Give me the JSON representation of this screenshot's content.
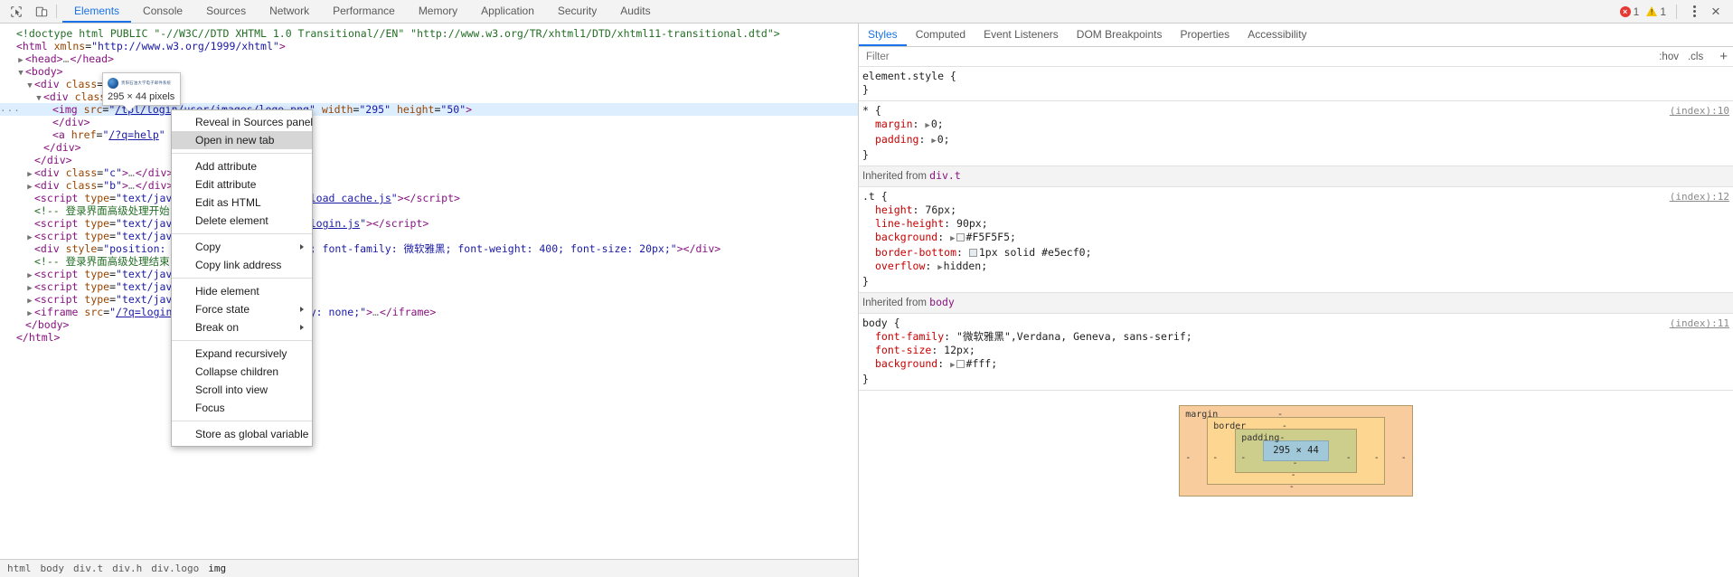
{
  "toolbar": {
    "icons": [
      {
        "name": "inspect-element-icon",
        "glyph": "inspect"
      },
      {
        "name": "device-toolbar-icon",
        "glyph": "device"
      }
    ],
    "tabs": [
      {
        "label": "Elements",
        "active": true
      },
      {
        "label": "Console",
        "active": false
      },
      {
        "label": "Sources",
        "active": false
      },
      {
        "label": "Network",
        "active": false
      },
      {
        "label": "Performance",
        "active": false
      },
      {
        "label": "Memory",
        "active": false
      },
      {
        "label": "Application",
        "active": false
      },
      {
        "label": "Security",
        "active": false
      },
      {
        "label": "Audits",
        "active": false
      }
    ],
    "error_count": "1",
    "warning_count": "1",
    "more_label": "More options",
    "close_label": "×"
  },
  "dom": {
    "lines": [
      {
        "indent": 0,
        "twisty": "none",
        "html": "<span class=\"comment\">&lt;!doctype html PUBLIC \"-//W3C//DTD XHTML 1.0 Transitional//EN\" \"http://www.w3.org/TR/xhtml1/DTD/xhtml11-transitional.dtd\"&gt;</span>"
      },
      {
        "indent": 0,
        "twisty": "none",
        "html": "<span class=\"tag\">&lt;html</span> <span class=\"attrname\">xmlns</span>=<span class=\"attrval\">\"http://www.w3.org/1999/xhtml\"</span><span class=\"tag\">&gt;</span>"
      },
      {
        "indent": 1,
        "twisty": "closed",
        "html": "<span class=\"tag\">&lt;head&gt;</span><span class=\"ellipsis-dots\">…</span><span class=\"tag\">&lt;/head&gt;</span>"
      },
      {
        "indent": 1,
        "twisty": "open",
        "html": "<span class=\"tag\">&lt;body&gt;</span>"
      },
      {
        "indent": 2,
        "twisty": "open",
        "html": "<span class=\"tag\">&lt;div</span> <span class=\"attrname\">class</span>=<span class=\"attrval\">\"t\"</span><span class=\"tag\">&gt;</span>"
      },
      {
        "indent": 3,
        "twisty": "open",
        "html": "<span class=\"tag\">&lt;div</span> <span class=\"attrname\">class</span>=<span class=\"attrval\">\"logo\"</span><span class=\"tag\">&gt;</span>"
      },
      {
        "indent": 4,
        "twisty": "none",
        "selected": true,
        "dots": true,
        "html": "<span class=\"tag\">&lt;img</span> <span class=\"attrname\">src</span>=<span class=\"attrval\">\"</span><span class=\"link\">/tpl/login/user/images/logo.png</span><span class=\"attrval\">\"</span> <span class=\"attrname\">width</span>=<span class=\"attrval\">\"295\"</span> <span class=\"attrname\">height</span>=<span class=\"attrval\">\"50\"</span><span class=\"tag\">&gt;</span>"
      },
      {
        "indent": 4,
        "twisty": "none",
        "html": "<span class=\"tag\">&lt;/div&gt;</span>"
      },
      {
        "indent": 4,
        "twisty": "none",
        "html": "<span class=\"tag\">&lt;a</span> <span class=\"attrname\">href</span>=<span class=\"attrval\">\"</span><span class=\"link\">/?q=help</span><span class=\"attrval\">\"</span> <span class=\"attrname\">target</span>=<span class=\"attrval\">\"_blank\"</span><span class=\"tag\">&gt;</span><span class=\"ellipsis-dots\">…</span><span class=\"tag\">&lt;/a&gt;</span>"
      },
      {
        "indent": 3,
        "twisty": "none",
        "html": "<span class=\"tag\">&lt;/div&gt;</span>"
      },
      {
        "indent": 2,
        "twisty": "none",
        "html": "<span class=\"tag\">&lt;/div&gt;</span>"
      },
      {
        "indent": 2,
        "twisty": "closed",
        "html": "<span class=\"tag\">&lt;div</span> <span class=\"attrname\">class</span>=<span class=\"attrval\">\"c\"</span><span class=\"tag\">&gt;</span><span class=\"ellipsis-dots\">…</span><span class=\"tag\">&lt;/div&gt;</span>"
      },
      {
        "indent": 2,
        "twisty": "closed",
        "html": "<span class=\"tag\">&lt;div</span> <span class=\"attrname\">class</span>=<span class=\"attrval\">\"b\"</span><span class=\"tag\">&gt;</span><span class=\"ellipsis-dots\">…</span><span class=\"tag\">&lt;/div&gt;</span>"
      },
      {
        "indent": 2,
        "twisty": "none",
        "html": "<span class=\"tag\">&lt;script</span> <span class=\"attrname\">type</span>=<span class=\"attrval\">\"text/javascript\"</span> <span class=\"attrname\">src</span>=<span class=\"attrval\">\"</span><span class=\"link\">/tpl/js/load cache.js</span><span class=\"attrval\">\"</span><span class=\"tag\">&gt;&lt;/script&gt;</span>"
      },
      {
        "indent": 2,
        "twisty": "none",
        "html": "<span class=\"comment\">&lt;!-- 登录界面高级处理开始 --&gt;</span>"
      },
      {
        "indent": 2,
        "twisty": "none",
        "html": "<span class=\"tag\">&lt;script</span> <span class=\"attrname\">type</span>=<span class=\"attrval\">\"text/javascript\"</span> <span class=\"attrname\">src</span>=<span class=\"attrval\">\"</span><span class=\"link\">/tpl/js/login.js</span><span class=\"attrval\">\"</span><span class=\"tag\">&gt;&lt;/script&gt;</span>"
      },
      {
        "indent": 2,
        "twisty": "closed",
        "html": "<span class=\"tag\">&lt;script</span> <span class=\"attrname\">type</span>=<span class=\"attrval\">\"text/javascript\"</span><span class=\"tag\">&gt;</span><span class=\"ellipsis-dots\">…</span><span class=\"tag\">&lt;/script&gt;</span>"
      },
      {
        "indent": 2,
        "twisty": "none",
        "html": "<span class=\"tag\">&lt;div</span> <span class=\"attrname\">style</span>=<span class=\"attrval\">\"position: absolute; color: black; font-family: 微软雅黑; font-weight: 400; font-size: 20px;\"</span><span class=\"tag\">&gt;&lt;/div&gt;</span>"
      },
      {
        "indent": 2,
        "twisty": "none",
        "html": "<span class=\"comment\">&lt;!-- 登录界面高级处理结束 --&gt;</span>"
      },
      {
        "indent": 2,
        "twisty": "closed",
        "html": "<span class=\"tag\">&lt;script</span> <span class=\"attrname\">type</span>=<span class=\"attrval\">\"text/javascript\"</span><span class=\"tag\">&gt;</span><span class=\"ellipsis-dots\">…</span><span class=\"tag\">&lt;/script&gt;</span>"
      },
      {
        "indent": 2,
        "twisty": "closed",
        "html": "<span class=\"tag\">&lt;script</span> <span class=\"attrname\">type</span>=<span class=\"attrval\">\"text/javascript\"</span><span class=\"tag\">&gt;</span><span class=\"ellipsis-dots\">…</span><span class=\"tag\">&lt;/script&gt;</span>"
      },
      {
        "indent": 2,
        "twisty": "closed",
        "html": "<span class=\"tag\">&lt;script</span> <span class=\"attrname\">type</span>=<span class=\"attrval\">\"text/javascript\"</span><span class=\"tag\">&gt;</span><span class=\"ellipsis-dots\">…</span><span class=\"tag\">&lt;/script&gt;</span>"
      },
      {
        "indent": 2,
        "twisty": "closed",
        "html": "<span class=\"tag\">&lt;iframe</span> <span class=\"attrname\">src</span>=<span class=\"attrval\">\"</span><span class=\"link\">/?q=login.load c</span><span class=\"attrval\">\"</span> <span class=\"attrname\">style</span>=<span class=\"attrval\">\"display: none;\"</span><span class=\"tag\">&gt;</span><span class=\"ellipsis-dots\">…</span><span class=\"tag\">&lt;/iframe&gt;</span>"
      },
      {
        "indent": 1,
        "twisty": "none",
        "html": "<span class=\"tag\">&lt;/body&gt;</span>"
      },
      {
        "indent": 0,
        "twisty": "none",
        "html": "<span class=\"tag\">&lt;/html&gt;</span>"
      }
    ],
    "breadcrumb": [
      {
        "label": "html",
        "active": false
      },
      {
        "label": "body",
        "active": false
      },
      {
        "label": "div.t",
        "active": false
      },
      {
        "label": "div.h",
        "active": false
      },
      {
        "label": "div.logo",
        "active": false
      },
      {
        "label": "img",
        "active": true
      }
    ]
  },
  "tooltip": {
    "logo_text": "贵阳石油大学电子邮件系统",
    "dimensions": "295 × 44 pixels"
  },
  "context_menu": {
    "groups": [
      [
        {
          "label": "Reveal in Sources panel",
          "highlighted": false,
          "submenu": false
        },
        {
          "label": "Open in new tab",
          "highlighted": true,
          "submenu": false
        }
      ],
      [
        {
          "label": "Add attribute",
          "highlighted": false,
          "submenu": false
        },
        {
          "label": "Edit attribute",
          "highlighted": false,
          "submenu": false
        },
        {
          "label": "Edit as HTML",
          "highlighted": false,
          "submenu": false
        },
        {
          "label": "Delete element",
          "highlighted": false,
          "submenu": false
        }
      ],
      [
        {
          "label": "Copy",
          "highlighted": false,
          "submenu": true
        },
        {
          "label": "Copy link address",
          "highlighted": false,
          "submenu": false
        }
      ],
      [
        {
          "label": "Hide element",
          "highlighted": false,
          "submenu": false
        },
        {
          "label": "Force state",
          "highlighted": false,
          "submenu": true
        },
        {
          "label": "Break on",
          "highlighted": false,
          "submenu": true
        }
      ],
      [
        {
          "label": "Expand recursively",
          "highlighted": false,
          "submenu": false
        },
        {
          "label": "Collapse children",
          "highlighted": false,
          "submenu": false
        },
        {
          "label": "Scroll into view",
          "highlighted": false,
          "submenu": false
        },
        {
          "label": "Focus",
          "highlighted": false,
          "submenu": false
        }
      ],
      [
        {
          "label": "Store as global variable",
          "highlighted": false,
          "submenu": false
        }
      ]
    ]
  },
  "sidebar": {
    "tabs": [
      {
        "label": "Styles",
        "active": true
      },
      {
        "label": "Computed",
        "active": false
      },
      {
        "label": "Event Listeners",
        "active": false
      },
      {
        "label": "DOM Breakpoints",
        "active": false
      },
      {
        "label": "Properties",
        "active": false
      },
      {
        "label": "Accessibility",
        "active": false
      }
    ],
    "filter": {
      "placeholder": "Filter",
      "value": "",
      "hov_label": ":hov",
      "cls_label": ".cls",
      "new_rule_label": "+"
    },
    "rules": [
      {
        "selector": "element.style {",
        "close": "}",
        "source": "",
        "properties": []
      },
      {
        "selector": "* {",
        "close": "}",
        "source": "(index):10",
        "properties": [
          {
            "name": "margin",
            "value": "0;",
            "expandable": true,
            "swatch": null
          },
          {
            "name": "padding",
            "value": "0;",
            "expandable": true,
            "swatch": null
          }
        ]
      }
    ],
    "inherited_sections": [
      {
        "header_prefix": "Inherited from",
        "header_target": "div.t",
        "rules": [
          {
            "selector": ".t {",
            "close": "}",
            "source": "(index):12",
            "properties": [
              {
                "name": "height",
                "value": "76px;",
                "expandable": false,
                "swatch": null
              },
              {
                "name": "line-height",
                "value": "90px;",
                "expandable": false,
                "swatch": null
              },
              {
                "name": "background",
                "value": "#F5F5F5;",
                "expandable": true,
                "swatch": "#F5F5F5"
              },
              {
                "name": "border-bottom",
                "value": "1px solid #e5ecf0;",
                "expandable": false,
                "swatch": "#e5ecf0"
              },
              {
                "name": "overflow",
                "value": "hidden;",
                "expandable": true,
                "swatch": null
              }
            ]
          }
        ]
      },
      {
        "header_prefix": "Inherited from",
        "header_target": "body",
        "rules": [
          {
            "selector": "body {",
            "close": "}",
            "source": "(index):11",
            "properties": [
              {
                "name": "font-family",
                "value": "\"微软雅黑\",Verdana, Geneva, sans-serif;",
                "expandable": false,
                "swatch": null
              },
              {
                "name": "font-size",
                "value": "12px;",
                "expandable": false,
                "swatch": null
              },
              {
                "name": "background",
                "value": "#fff;",
                "expandable": true,
                "swatch": "#ffffff"
              }
            ]
          }
        ]
      }
    ],
    "box_model": {
      "margin_label": "margin",
      "margin_values": [
        "-",
        "-",
        "-",
        "-"
      ],
      "border_label": "border",
      "border_values": [
        "-",
        "-",
        "-",
        "-"
      ],
      "padding_label": "padding-",
      "padding_values": [
        "-",
        "-",
        "-",
        "-"
      ],
      "content": "295 × 44"
    }
  },
  "colors": {
    "accent": "#1a73e8",
    "selection": "#ddeeff",
    "tag": "#881280",
    "attr_name": "#994500",
    "attr_value": "#1a1aa6",
    "comment": "#236e25",
    "prop_name": "#c80000",
    "error": "#e53935",
    "warning": "#f2c200",
    "box_margin": "#f9cc9d",
    "box_border": "#fdd791",
    "box_padding": "#cdcd8c",
    "box_content": "#a1c8d8"
  }
}
